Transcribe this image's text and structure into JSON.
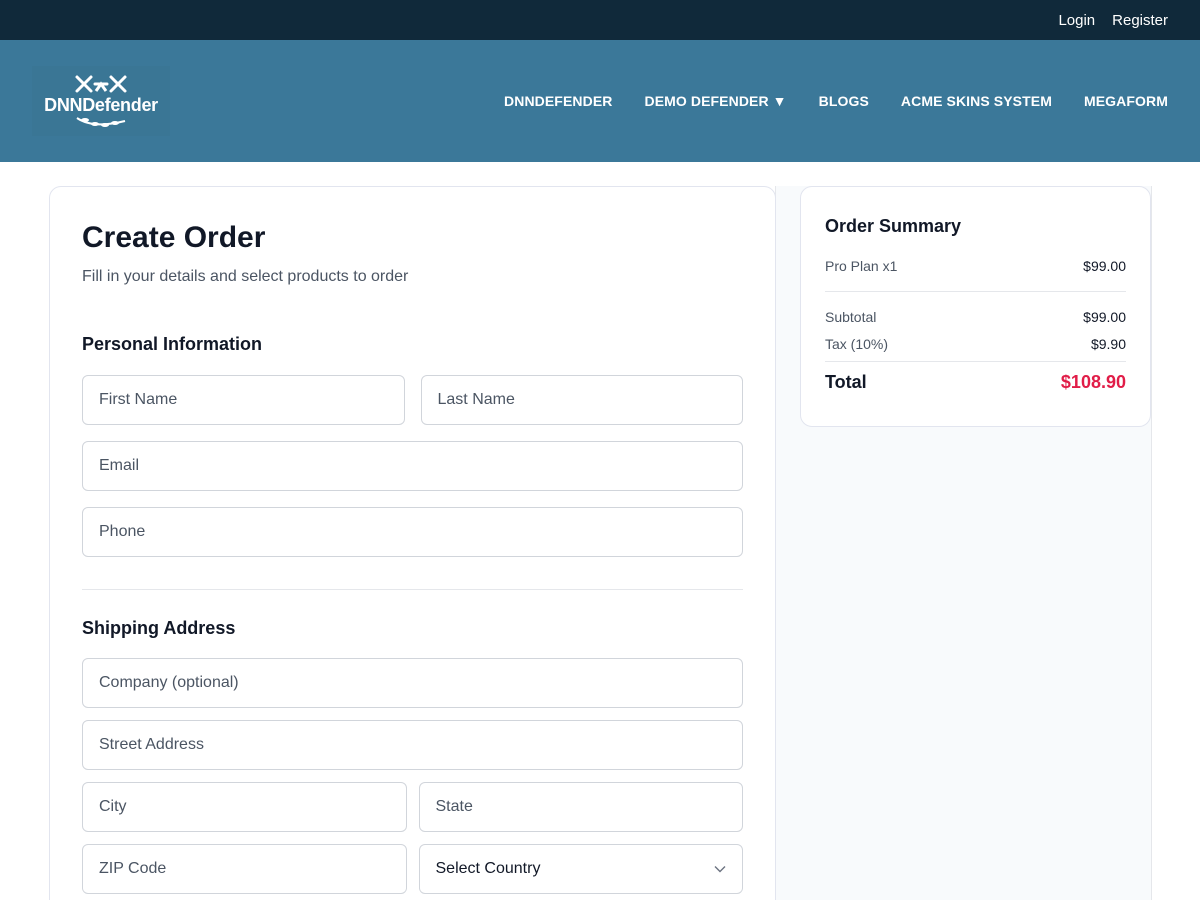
{
  "topbar": {
    "login": "Login",
    "register": "Register"
  },
  "header": {
    "logo_text": "DNNDefender",
    "nav": [
      "DNNDEFENDER",
      "DEMO DEFENDER ▼",
      "BLOGS",
      "ACME SKINS SYSTEM",
      "MEGAFORM"
    ]
  },
  "form": {
    "title": "Create Order",
    "subtitle": "Fill in your details and select products to order",
    "personal_heading": "Personal Information",
    "first_name_placeholder": "First Name",
    "last_name_placeholder": "Last Name",
    "email_placeholder": "Email",
    "phone_placeholder": "Phone",
    "shipping_heading": "Shipping Address",
    "company_placeholder": "Company (optional)",
    "street_placeholder": "Street Address",
    "city_placeholder": "City",
    "state_placeholder": "State",
    "zip_placeholder": "ZIP Code",
    "country_select": "Select Country"
  },
  "summary": {
    "title": "Order Summary",
    "item_label": "Pro Plan x1",
    "item_price": "$99.00",
    "subtotal_label": "Subtotal",
    "subtotal_value": "$99.00",
    "tax_label": "Tax (10%)",
    "tax_value": "$9.90",
    "total_label": "Total",
    "total_value": "$108.90"
  },
  "colors": {
    "topbar": "#10293a",
    "header": "#3b7899",
    "total": "#e11d48"
  }
}
